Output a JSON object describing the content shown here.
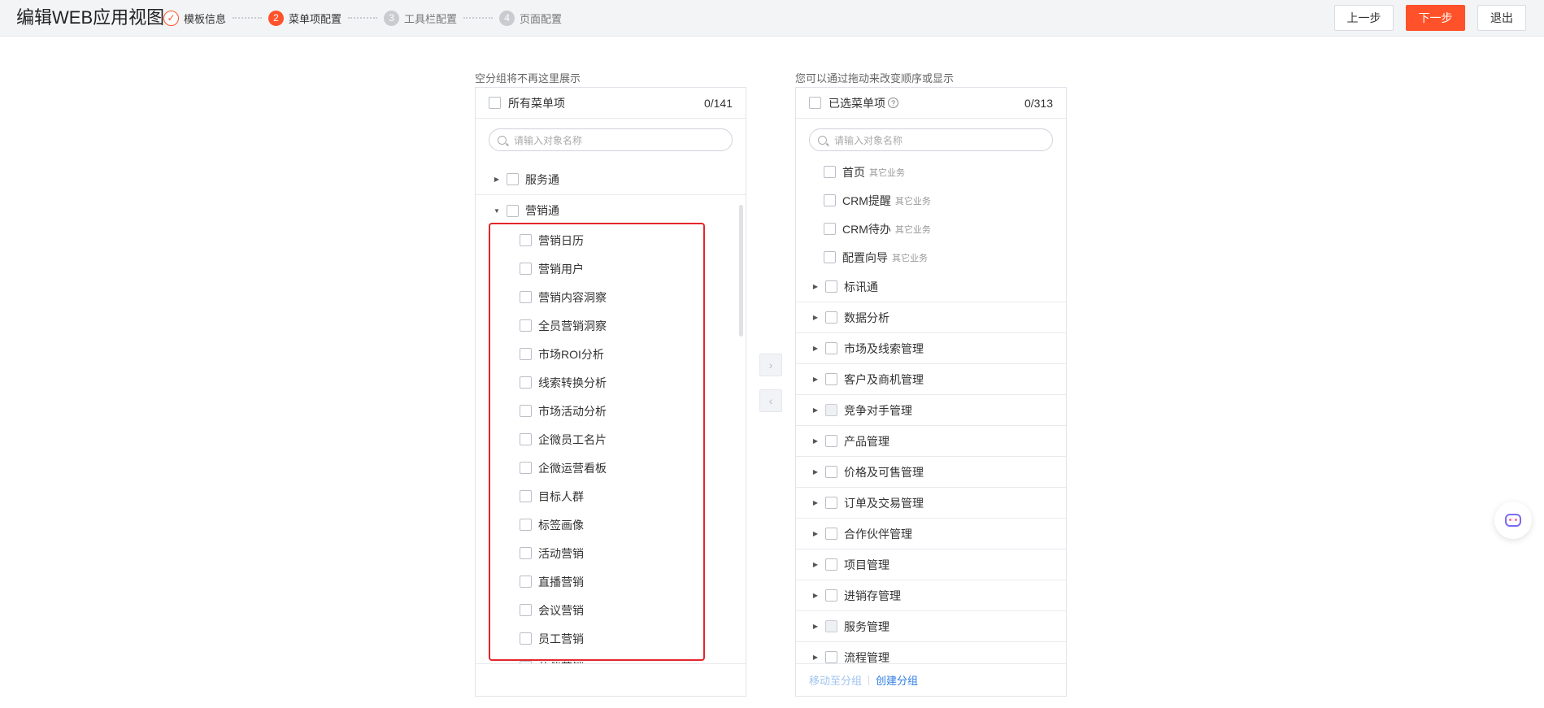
{
  "header": {
    "title": "编辑WEB应用视图",
    "steps": [
      {
        "num": "✓",
        "label": "模板信息"
      },
      {
        "num": "2",
        "label": "菜单项配置"
      },
      {
        "num": "3",
        "label": "工具栏配置"
      },
      {
        "num": "4",
        "label": "页面配置"
      }
    ],
    "prev_label": "上一步",
    "next_label": "下一步",
    "exit_label": "退出"
  },
  "left_panel": {
    "hint": "空分组将不再这里展示",
    "head_label": "所有菜单项",
    "count": "0/141",
    "search_placeholder": "请输入对象名称",
    "groups": [
      {
        "label": "服务通",
        "expanded": false
      },
      {
        "label": "营销通",
        "expanded": true
      }
    ],
    "items": [
      "营销日历",
      "营销用户",
      "营销内容洞察",
      "全员营销洞察",
      "市场ROI分析",
      "线索转换分析",
      "市场活动分析",
      "企微员工名片",
      "企微运营看板",
      "目标人群",
      "标签画像",
      "活动营销",
      "直播营销",
      "会议营销",
      "员工营销",
      "伙伴营销"
    ]
  },
  "right_panel": {
    "hint": "您可以通过拖动来改变顺序或显示",
    "head_label": "已选菜单项",
    "help_glyph": "?",
    "count": "0/313",
    "search_placeholder": "请输入对象名称",
    "items": [
      {
        "label": "首页",
        "biz": "其它业务"
      },
      {
        "label": "CRM提醒",
        "biz": "其它业务"
      },
      {
        "label": "CRM待办",
        "biz": "其它业务"
      },
      {
        "label": "配置向导",
        "biz": "其它业务"
      }
    ],
    "groups": [
      {
        "label": "标讯通",
        "disabled": false
      },
      {
        "label": "数据分析",
        "disabled": false
      },
      {
        "label": "市场及线索管理",
        "disabled": false
      },
      {
        "label": "客户及商机管理",
        "disabled": false
      },
      {
        "label": "竞争对手管理",
        "disabled": true
      },
      {
        "label": "产品管理",
        "disabled": false
      },
      {
        "label": "价格及可售管理",
        "disabled": false
      },
      {
        "label": "订单及交易管理",
        "disabled": false
      },
      {
        "label": "合作伙伴管理",
        "disabled": false
      },
      {
        "label": "项目管理",
        "disabled": false
      },
      {
        "label": "进销存管理",
        "disabled": false
      },
      {
        "label": "服务管理",
        "disabled": true
      },
      {
        "label": "流程管理",
        "disabled": false
      }
    ],
    "footer": {
      "move_label": "移动至分组",
      "create_label": "创建分组"
    }
  },
  "transfer": {
    "to_right": "›",
    "to_left": "‹"
  },
  "bottom_hint": "营销日历"
}
